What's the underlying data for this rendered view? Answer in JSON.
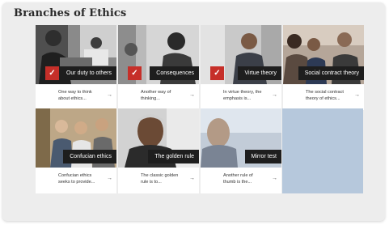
{
  "page": {
    "title": "Branches of Ethics"
  },
  "cards": [
    {
      "label": "Our duty to others",
      "desc1": "One way to think",
      "desc2": "about ethics...",
      "checked": true
    },
    {
      "label": "Consequences",
      "desc1": "Another way of",
      "desc2": "thinking...",
      "checked": true
    },
    {
      "label": "Virtue theory",
      "desc1": "In virtue theory, the",
      "desc2": "emphasis is...",
      "checked": true
    },
    {
      "label": "Social contract theory",
      "desc1": "The social contract",
      "desc2": "theory of ethics...",
      "checked": false
    },
    {
      "label": "Confucian ethics",
      "desc1": "Confucian ethics",
      "desc2": "seeks to provide...",
      "checked": false
    },
    {
      "label": "The golden rule",
      "desc1": "The classic golden",
      "desc2": "rule is to...",
      "checked": false
    },
    {
      "label": "Mirror test",
      "desc1": "Another rule of",
      "desc2": "thumb is the...",
      "checked": false
    }
  ],
  "icons": {
    "check": "✓",
    "arrow": "→"
  },
  "colors": {
    "check_bg": "#c62f29",
    "label_bg": "#1e1e1e"
  }
}
